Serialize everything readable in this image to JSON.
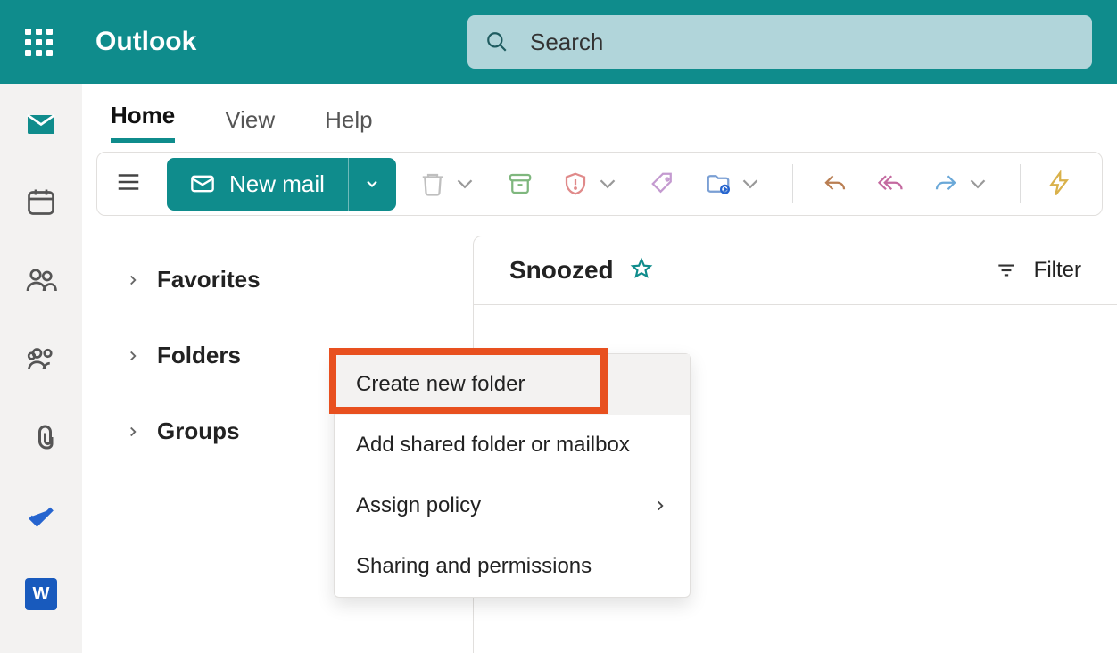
{
  "header": {
    "app_title": "Outlook",
    "search_placeholder": "Search"
  },
  "tabs": {
    "home": "Home",
    "view": "View",
    "help": "Help"
  },
  "toolbar": {
    "new_mail": "New mail"
  },
  "nav": {
    "favorites": "Favorites",
    "folders": "Folders",
    "groups": "Groups"
  },
  "context_menu": {
    "create_new_folder": "Create new folder",
    "add_shared": "Add shared folder or mailbox",
    "assign_policy": "Assign policy",
    "sharing_permissions": "Sharing and permissions"
  },
  "list": {
    "folder_name": "Snoozed",
    "filter_label": "Filter"
  },
  "rail": {
    "word_glyph": "W"
  }
}
